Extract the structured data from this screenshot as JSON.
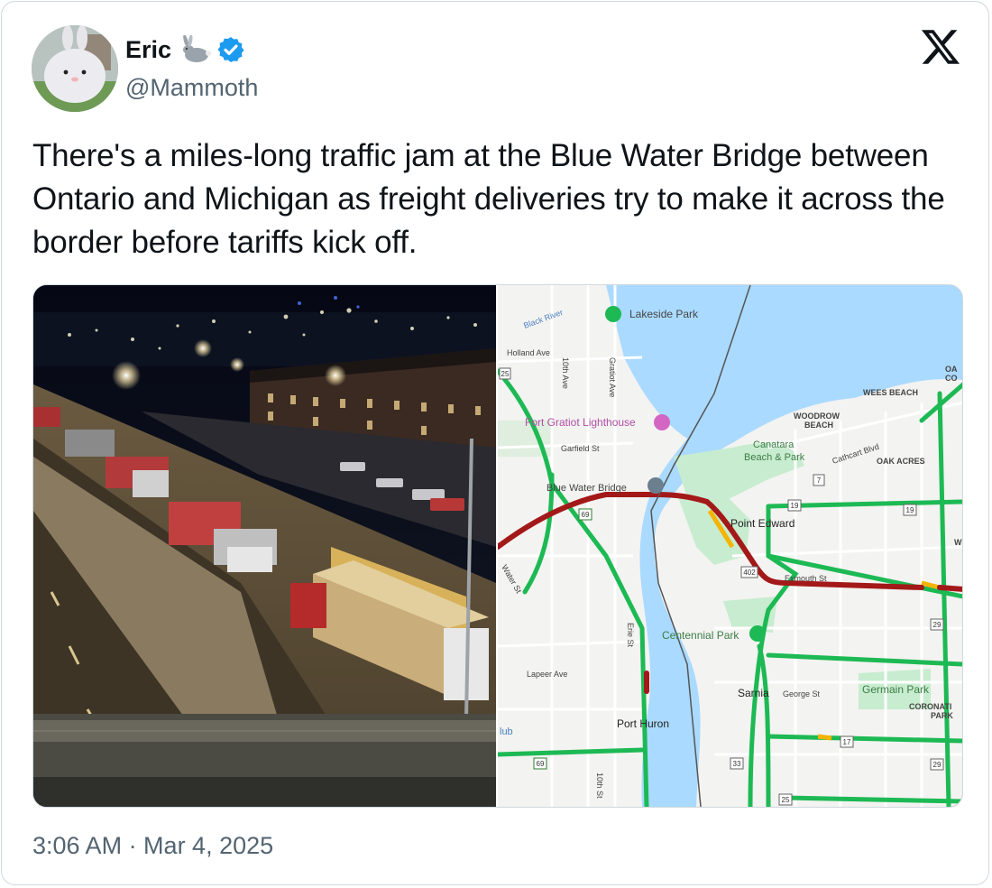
{
  "author": {
    "name": "Eric",
    "handle": "@Mammoth",
    "name_emoji_icon": "rabbit-icon",
    "verified_icon": "verified-badge-icon",
    "verified_color": "#1d9bf0"
  },
  "brand": {
    "logo_icon": "x-logo-icon"
  },
  "tweet": {
    "text": "There's a miles-long traffic jam at the Blue Water Bridge between Ontario and Michigan as freight deliveries try to make it across the border before tariffs kick off.",
    "timestamp": "3:06 AM · Mar 4, 2025"
  },
  "media": {
    "photo_description_icon": "traffic-camera-photo",
    "map": {
      "colors": {
        "water": "#aadaff",
        "jam": "#a31919",
        "slow": "#f4b400",
        "free": "#1db954",
        "land": "#f3f3f1",
        "park": "#c8eccf"
      },
      "labels": {
        "lakeside_park": "Lakeside Park",
        "black_river": "Black River",
        "holland_ave": "Holland Ave",
        "tenth_ave": "10th Ave",
        "gratiot_ave": "Gratiot Ave",
        "fort_gratiot": "Fort Gratiot Lighthouse",
        "garfield_st": "Garfield St",
        "blue_water_bridge": "Blue Water Bridge",
        "wees_beach": "WEES BEACH",
        "woodrow_beach_1": "WOODROW",
        "woodrow_beach_2": "BEACH",
        "canatara_1": "Canatara",
        "canatara_2": "Beach & Park",
        "cathcart_blvd": "Cathcart Blvd",
        "oak_acres": "OAK ACRES",
        "point_edward": "Point Edward",
        "exmouth_st": "Exmouth St",
        "centennial_park": "Centennial Park",
        "lapeer_ave": "Lapeer Ave",
        "erie_st": "Erie St",
        "water_st": "Water St",
        "sarnia": "Sarnia",
        "george_st": "George St",
        "germain_park": "Germain Park",
        "coronation_1": "CORONATI",
        "coronation_2": "PARK",
        "port_huron": "Port Huron",
        "tenth_st": "10th St",
        "club": "lub",
        "oa_1": "OA",
        "oa_2": "CO",
        "w": "W",
        "shield_25": "25",
        "shield_69": "69",
        "shield_7": "7",
        "shield_19a": "19",
        "shield_19b": "19",
        "shield_402": "402",
        "shield_29a": "29",
        "shield_29b": "29",
        "shield_17": "17",
        "shield_33": "33",
        "shield_25b": "25",
        "shield_69b": "69"
      }
    }
  }
}
